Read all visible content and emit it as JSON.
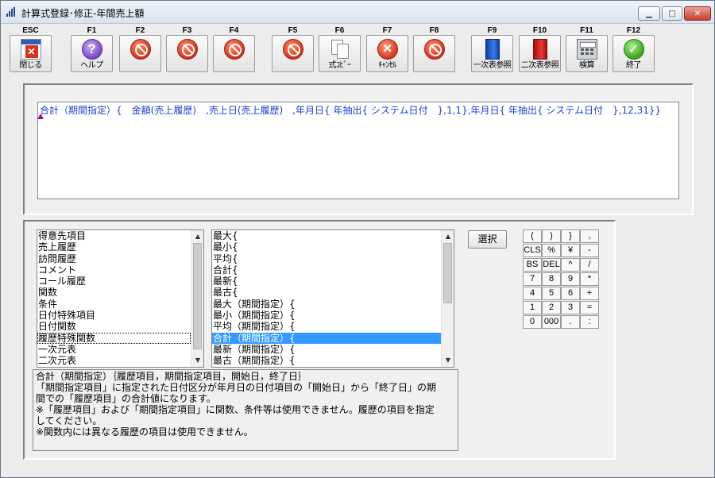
{
  "window": {
    "title": "計算式登録･修正-年間売上額",
    "controls": {
      "minimize": "▁",
      "maximize": "□",
      "close": "✕"
    }
  },
  "function_keys": [
    {
      "key": "ESC",
      "caption": "閉じる",
      "icon": "close-window-icon"
    },
    {
      "key": "F1",
      "caption": "ヘルプ",
      "icon": "help-icon"
    },
    {
      "key": "F2",
      "caption": "",
      "icon": "disabled-icon"
    },
    {
      "key": "F3",
      "caption": "",
      "icon": "disabled-icon"
    },
    {
      "key": "F4",
      "caption": "",
      "icon": "disabled-icon"
    },
    {
      "key": "F5",
      "caption": "",
      "icon": "disabled-icon"
    },
    {
      "key": "F6",
      "caption": "式ｺﾋﾟｰ",
      "icon": "copy-icon"
    },
    {
      "key": "F7",
      "caption": "ｷｬﾝｾﾙ",
      "icon": "cancel-icon"
    },
    {
      "key": "F8",
      "caption": "",
      "icon": "disabled-icon"
    },
    {
      "key": "F9",
      "caption": "一次表参照",
      "icon": "blue-book-icon"
    },
    {
      "key": "F10",
      "caption": "二次表参照",
      "icon": "red-book-icon"
    },
    {
      "key": "F11",
      "caption": "検算",
      "icon": "calculator-icon"
    },
    {
      "key": "F12",
      "caption": "終了",
      "icon": "check-icon"
    }
  ],
  "formula": {
    "text": "合計（期間指定）{　金額(売上履歴)　,売上日(売上履歴)　,年月日{ 年抽出{ システム日付　},1,1},年月日{ 年抽出{ システム日付　},12,31}}"
  },
  "category_list": {
    "items": [
      "得意先項目",
      "売上履歴",
      "訪問履歴",
      "コメント",
      "コール履歴",
      "関数",
      "条件",
      "日付特殊項目",
      "日付関数",
      "履歴特殊関数",
      "一次元表",
      "二次元表"
    ],
    "focused_index": 9
  },
  "function_list": {
    "items": [
      "最大{",
      "最小{",
      "平均{",
      "合計{",
      "最新{",
      "最古{",
      "最大（期間指定）{",
      "最小（期間指定）{",
      "平均（期間指定）{",
      "合計（期間指定）{",
      "最新（期間指定）{",
      "最古（期間指定）{"
    ],
    "selected_index": 9
  },
  "description": {
    "lines": [
      "合計（期間指定）｛履歴項目，期間指定項目，開始日，終了日｝",
      "「期間指定項目」に指定された日付区分が年月日の日付項目の「開始日」から「終了日」の期",
      "間での「履歴項目」の合計値になります。",
      "※「履歴項目」および「期間指定項目」に関数、条件等は使用できません。履歴の項目を指定",
      "してください。",
      "※関数内には異なる履歴の項目は使用できません。"
    ]
  },
  "select_button": {
    "label": "選択"
  },
  "keypad": {
    "keys": [
      [
        "(",
        ")",
        "}",
        ","
      ],
      [
        "CLS",
        "%",
        "¥",
        "-"
      ],
      [
        "BS",
        "DEL",
        "^",
        "/"
      ],
      [
        "7",
        "8",
        "9",
        "*"
      ],
      [
        "4",
        "5",
        "6",
        "+"
      ],
      [
        "1",
        "2",
        "3",
        "="
      ],
      [
        "0",
        "000",
        ".",
        ":"
      ]
    ]
  }
}
